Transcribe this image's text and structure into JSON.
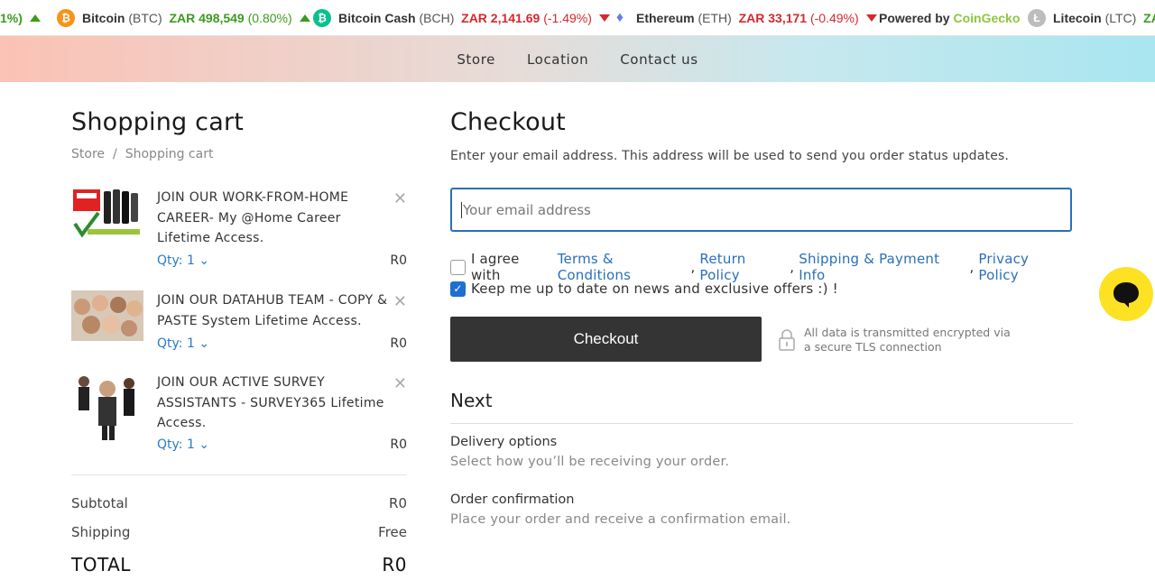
{
  "ticker": {
    "prefix_change": "1%)",
    "items": [
      {
        "name": "Bitcoin",
        "symbol": "(BTC)",
        "price": "ZAR 498,549",
        "change": "(0.80%)",
        "direction": "up",
        "icon": "bitcoin-icon",
        "icon_glyph": "₿",
        "color": "#f7931a"
      },
      {
        "name": "Bitcoin Cash",
        "symbol": "(BCH)",
        "price": "ZAR 2,141.69",
        "change": "(-1.49%)",
        "direction": "down",
        "icon": "bitcoin-cash-icon",
        "icon_glyph": "₿",
        "color": "#0ac18e"
      },
      {
        "name": "Ethereum",
        "symbol": "(ETH)",
        "price": "ZAR 33,171",
        "change": "(-0.49%)",
        "direction": "down",
        "icon": "ethereum-icon",
        "icon_glyph": "♦",
        "color": "#627eea"
      },
      {
        "name": "Litecoin",
        "symbol": "(LTC)",
        "price": "ZAR",
        "change": "",
        "direction": "",
        "icon": "litecoin-icon",
        "icon_glyph": "Ł",
        "color": "#bdbdbd"
      }
    ],
    "powered_label": "Powered by",
    "powered_brand": "CoinGecko"
  },
  "nav": {
    "store": "Store",
    "location": "Location",
    "contact": "Contact us"
  },
  "cart": {
    "title": "Shopping cart",
    "breadcrumb": {
      "root": "Store",
      "separator": "/",
      "current": "Shopping cart"
    },
    "items": [
      {
        "name": "JOIN OUR WORK-FROM-HOME CAREER- My @Home Career Lifetime Access.",
        "qty": "Qty: 1",
        "price": "R0"
      },
      {
        "name": "JOIN OUR DATAHUB TEAM - COPY & PASTE System Lifetime Access.",
        "qty": "Qty: 1",
        "price": "R0"
      },
      {
        "name": "JOIN OUR ACTIVE SURVEY ASSISTANTS - SURVEY365 Lifetime Access.",
        "qty": "Qty: 1",
        "price": "R0"
      }
    ],
    "subtotal_label": "Subtotal",
    "subtotal_value": "R0",
    "shipping_label": "Shipping",
    "shipping_value": "Free",
    "total_label": "TOTAL",
    "total_value": "R0"
  },
  "checkout": {
    "title": "Checkout",
    "description": "Enter your email address. This address will be used to send you order status updates.",
    "email_placeholder": "Your email address",
    "agree_prefix": "I agree with",
    "terms": "Terms & Conditions",
    "return_policy": "Return Policy",
    "shipping_info": "Shipping & Payment Info",
    "privacy": "Privacy Policy",
    "agree_checked": false,
    "newsletter_label": "Keep me up to date on news and exclusive offers :) !",
    "newsletter_checked": true,
    "button_label": "Checkout",
    "secure_text": "All data is transmitted encrypted via a secure TLS connection",
    "next_title": "Next",
    "steps": [
      {
        "title": "Delivery options",
        "description": "Select how you’ll be receiving your order."
      },
      {
        "title": "Order confirmation",
        "description": "Place your order and receive a confirmation email."
      }
    ]
  },
  "colors": {
    "accent": "#2a6fba",
    "button": "#343434",
    "chat": "#fde224",
    "up": "#3b9b1e",
    "down": "#d6282e"
  }
}
